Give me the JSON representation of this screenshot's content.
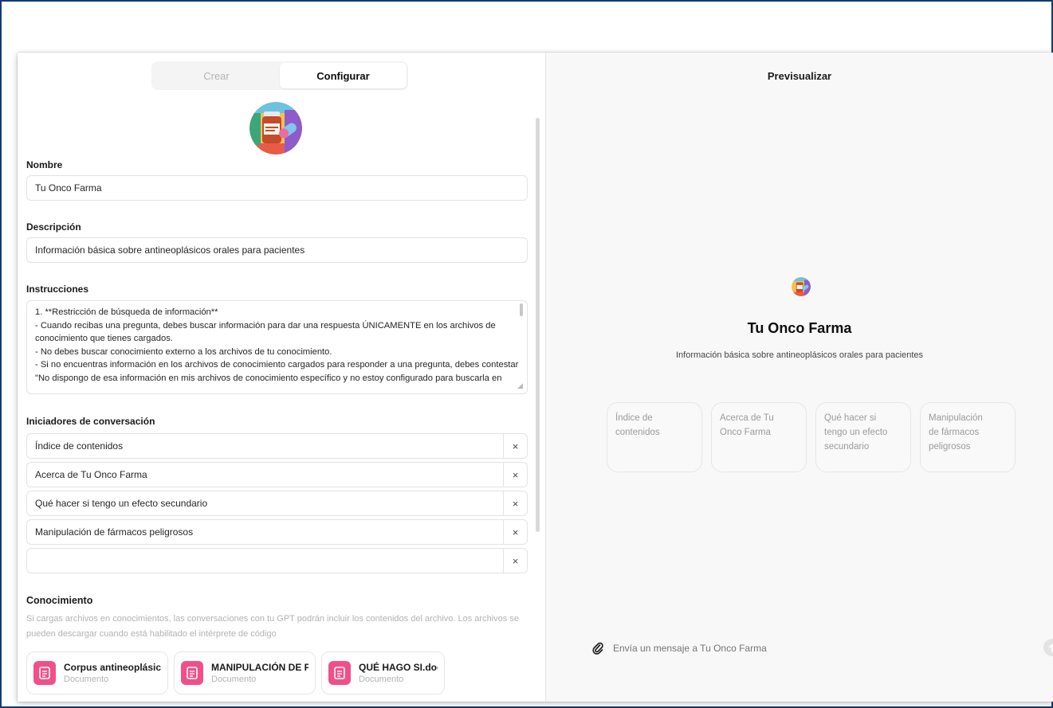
{
  "tabs": [
    {
      "label": "Crear",
      "active": false
    },
    {
      "label": "Configurar",
      "active": true
    }
  ],
  "form": {
    "name_label": "Nombre",
    "name_value": "Tu Onco Farma",
    "description_label": "Descripción",
    "description_value": "Información básica sobre antineoplásicos orales para pacientes",
    "instructions_label": "Instrucciones",
    "instructions_lines": [
      "1. **Restricción de búsqueda de información**",
      "- Cuando recibas una pregunta, debes buscar información para dar una respuesta ÚNICAMENTE en los archivos de",
      "conocimiento que tienes cargados.",
      "- No debes buscar conocimiento externo a los archivos de tu conocimiento.",
      "- Si no encuentras información en los archivos de conocimiento cargados para responder a una pregunta, debes contestar",
      "\"No dispongo de esa información en mis archivos de conocimiento específico y no estoy configurado para buscarla en"
    ],
    "starters_label": "Iniciadores de conversación",
    "starters": [
      "Índice de contenidos",
      "Acerca de Tu Onco Farma",
      "Qué hacer si tengo un efecto secundario",
      "Manipulación de fármacos peligrosos",
      ""
    ],
    "remove_symbol": "×",
    "knowledge_label": "Conocimiento",
    "knowledge_help": "Si cargas archivos en conocimientos, las conversaciones con tu GPT podrán incluir los contenidos del archivo. Los archivos se pueden descargar cuando está habilitado el intérprete de código",
    "files": [
      {
        "name": "Corpus antineoplásicos ...",
        "type": "Documento"
      },
      {
        "name": "MANIPULACIÓN DE FÁR...",
        "type": "Documento"
      },
      {
        "name": "QUÉ HAGO SI.docx",
        "type": "Documento"
      }
    ]
  },
  "preview": {
    "title": "Previsualizar",
    "gpt_name": "Tu Onco Farma",
    "gpt_description": "Información básica sobre antineoplásicos orales para pacientes",
    "suggestions": [
      [
        "Índice de",
        "contenidos"
      ],
      [
        "Acerca de Tu",
        "Onco Farma"
      ],
      [
        "Qué hacer si",
        "tengo un efecto",
        "secundario"
      ],
      [
        "Manipulación",
        "de fármacos",
        "peligrosos"
      ]
    ],
    "composer_placeholder": "Envía un mensaje a Tu Onco Farma"
  },
  "colors": {
    "file_icon": "#f0508a",
    "frame_border": "#123b6e"
  }
}
